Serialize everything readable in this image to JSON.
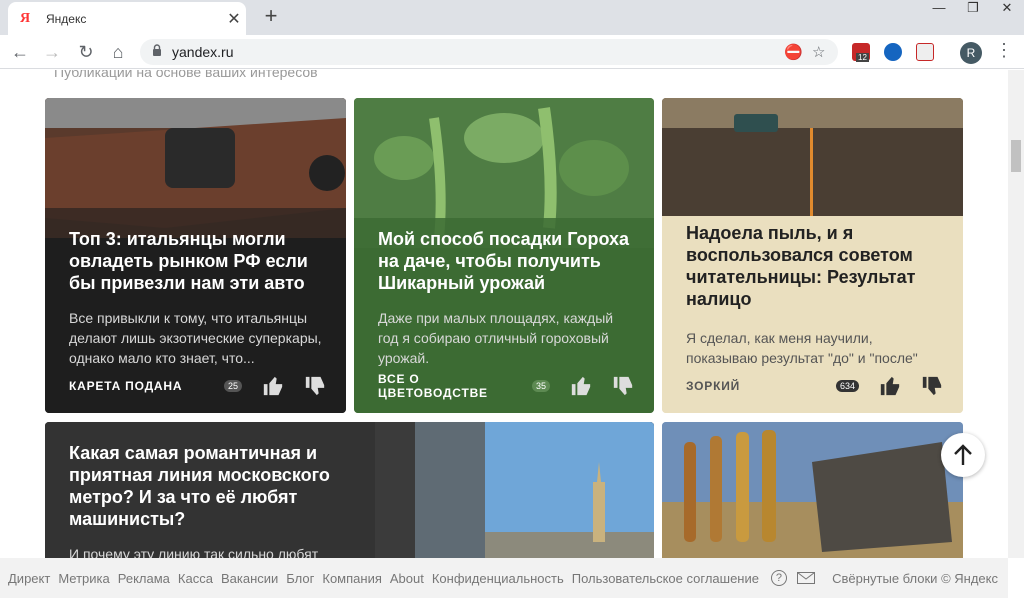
{
  "browser": {
    "tab_title": "Яндекс",
    "tab_favicon": "Я",
    "url": "yandex.ru",
    "extension_badge": "12",
    "avatar_letter": "R"
  },
  "page": {
    "subtitle": "Публикации на основе ваших интересов",
    "cards": [
      {
        "title": "Топ 3: итальянцы могли овладеть рынком РФ если бы привезли нам эти авто",
        "text": "Все привыкли к тому, что итальянцы делают лишь экзотические суперкары, однако мало кто знает, что...",
        "source": "КАРЕТА ПОДАНА",
        "count": "25"
      },
      {
        "title": "Мой способ посадки Гороха на даче, чтобы получить Шикарный урожай",
        "text": "Даже при малых площадях, каждый год я собираю отличный гороховый урожай.",
        "source_line1": "ВСЕ О",
        "source_line2": "ЦВЕТОВОДСТВЕ",
        "count": "35"
      },
      {
        "title": "Надоела пыль, и я воспользовался советом читательницы: Результат налицо",
        "text": "Я сделал, как меня научили, показываю результат \"до\" и \"после\"",
        "source": "ЗОРКИЙ",
        "count": "634"
      },
      {
        "title": "Какая самая романтичная и приятная линия московского метро? И за что её любят машинисты?",
        "text": "И почему эту линию так сильно любят"
      },
      {
        "title_partial": ""
      }
    ]
  },
  "footer": {
    "links": [
      "Директ",
      "Метрика",
      "Реклама",
      "Касса",
      "Вакансии",
      "Блог",
      "Компания",
      "About",
      "Конфиденциальность",
      "Пользовательское соглашение"
    ],
    "help": "?",
    "collapsed": "Свёрнутые блоки",
    "copyright": "© Яндекс"
  },
  "colors": {
    "card1_bg": "#1e1e1e",
    "card2_bg": "#3c6b34",
    "card3_bg": "#eadfbf",
    "card4_bg": "#333333"
  }
}
